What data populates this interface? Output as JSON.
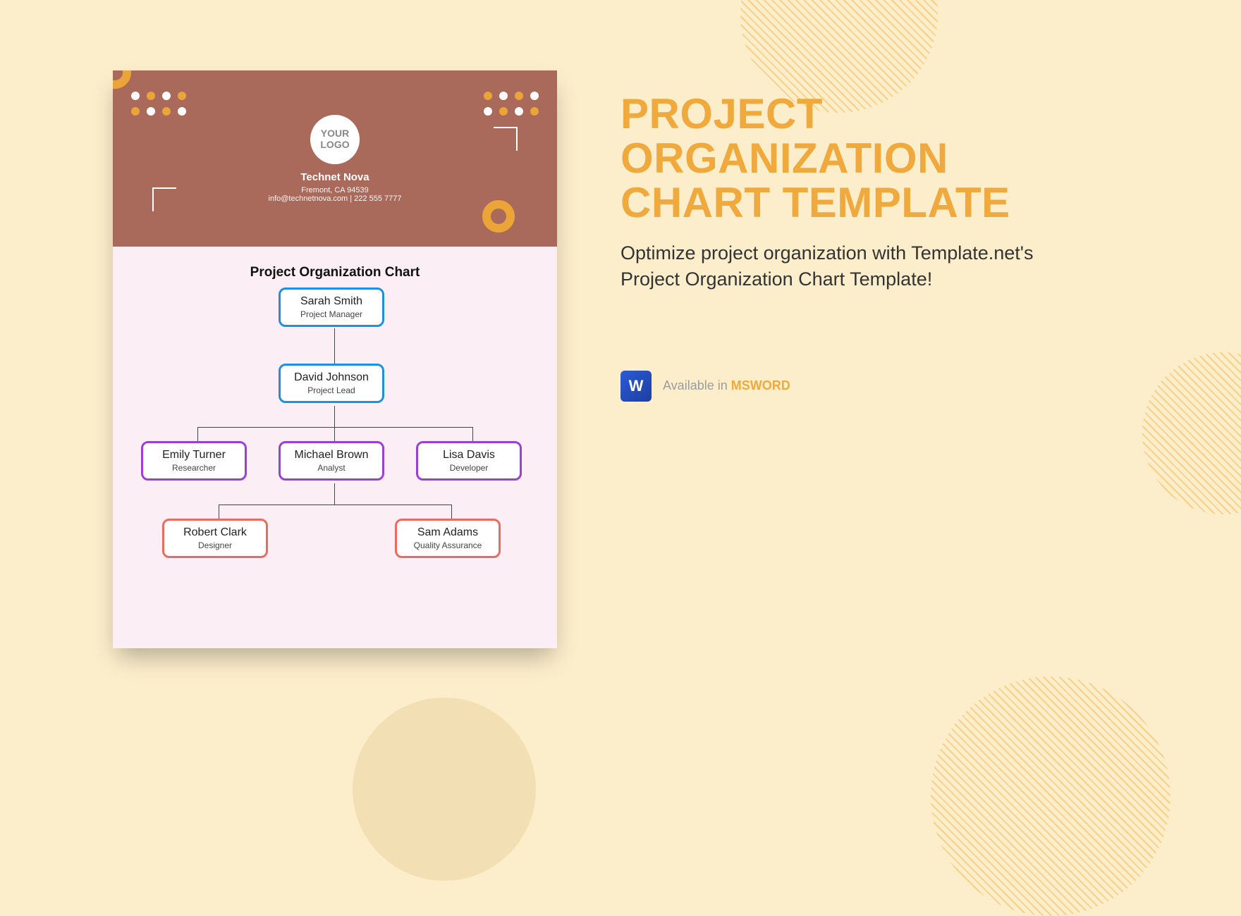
{
  "preview": {
    "logo_text": "YOUR LOGO",
    "company": "Technet Nova",
    "address": "Fremont, CA 94539",
    "contact": "info@technetnova.com | 222 555 7777",
    "chart_title": "Project Organization Chart"
  },
  "chart_data": {
    "type": "org-chart",
    "nodes": [
      {
        "id": "pm",
        "name": "Sarah Smith",
        "role": "Project Manager",
        "color": "blue",
        "level": 1
      },
      {
        "id": "pl",
        "name": "David Johnson",
        "role": "Project Lead",
        "color": "blue",
        "level": 2,
        "parent": "pm"
      },
      {
        "id": "r1",
        "name": "Emily Turner",
        "role": "Researcher",
        "color": "purple",
        "level": 3,
        "parent": "pl"
      },
      {
        "id": "r2",
        "name": "Michael Brown",
        "role": "Analyst",
        "color": "purple",
        "level": 3,
        "parent": "pl"
      },
      {
        "id": "r3",
        "name": "Lisa Davis",
        "role": "Developer",
        "color": "purple",
        "level": 3,
        "parent": "pl"
      },
      {
        "id": "b1",
        "name": "Robert Clark",
        "role": "Designer",
        "color": "coral",
        "level": 4,
        "parent": "r2"
      },
      {
        "id": "b2",
        "name": "Sam Adams",
        "role": "Quality Assurance",
        "color": "coral",
        "level": 4,
        "parent": "r2"
      }
    ]
  },
  "promo": {
    "title_line1": "PROJECT",
    "title_line2": "ORGANIZATION",
    "title_line3": "CHART TEMPLATE",
    "description": "Optimize project organization with Template.net's Project Organization Chart Template!",
    "available_prefix": "Available in",
    "available_format": "MSWORD"
  }
}
